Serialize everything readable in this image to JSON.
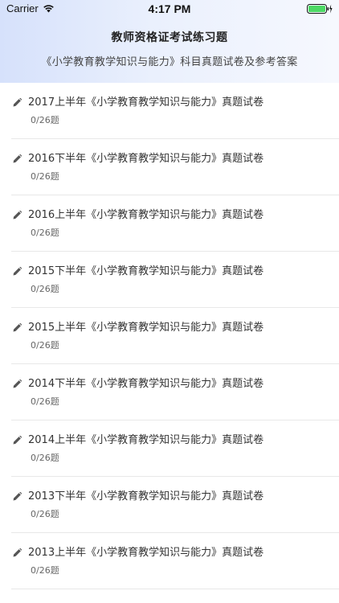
{
  "status_bar": {
    "carrier": "Carrier",
    "time": "4:17 PM",
    "wifi_icon": "wifi-icon",
    "battery_icon": "battery-charging-icon",
    "battery_color": "#4cd964"
  },
  "header": {
    "title": "教师资格证考试练习题",
    "subtitle": "《小学教育教学知识与能力》科目真题试卷及参考答案",
    "gradient_start": "#d6e1fb",
    "gradient_end": "#f6f8fe"
  },
  "list": {
    "item_icon": "pencil-icon",
    "items": [
      {
        "title": "2017上半年《小学教育教学知识与能力》真题试卷",
        "progress": "0/26题"
      },
      {
        "title": "2016下半年《小学教育教学知识与能力》真题试卷",
        "progress": "0/26题"
      },
      {
        "title": "2016上半年《小学教育教学知识与能力》真题试卷",
        "progress": "0/26题"
      },
      {
        "title": "2015下半年《小学教育教学知识与能力》真题试卷",
        "progress": "0/26题"
      },
      {
        "title": "2015上半年《小学教育教学知识与能力》真题试卷",
        "progress": "0/26题"
      },
      {
        "title": "2014下半年《小学教育教学知识与能力》真题试卷",
        "progress": "0/26题"
      },
      {
        "title": "2014上半年《小学教育教学知识与能力》真题试卷",
        "progress": "0/26题"
      },
      {
        "title": "2013下半年《小学教育教学知识与能力》真题试卷",
        "progress": "0/26题"
      },
      {
        "title": "2013上半年《小学教育教学知识与能力》真题试卷",
        "progress": "0/26题"
      }
    ]
  }
}
